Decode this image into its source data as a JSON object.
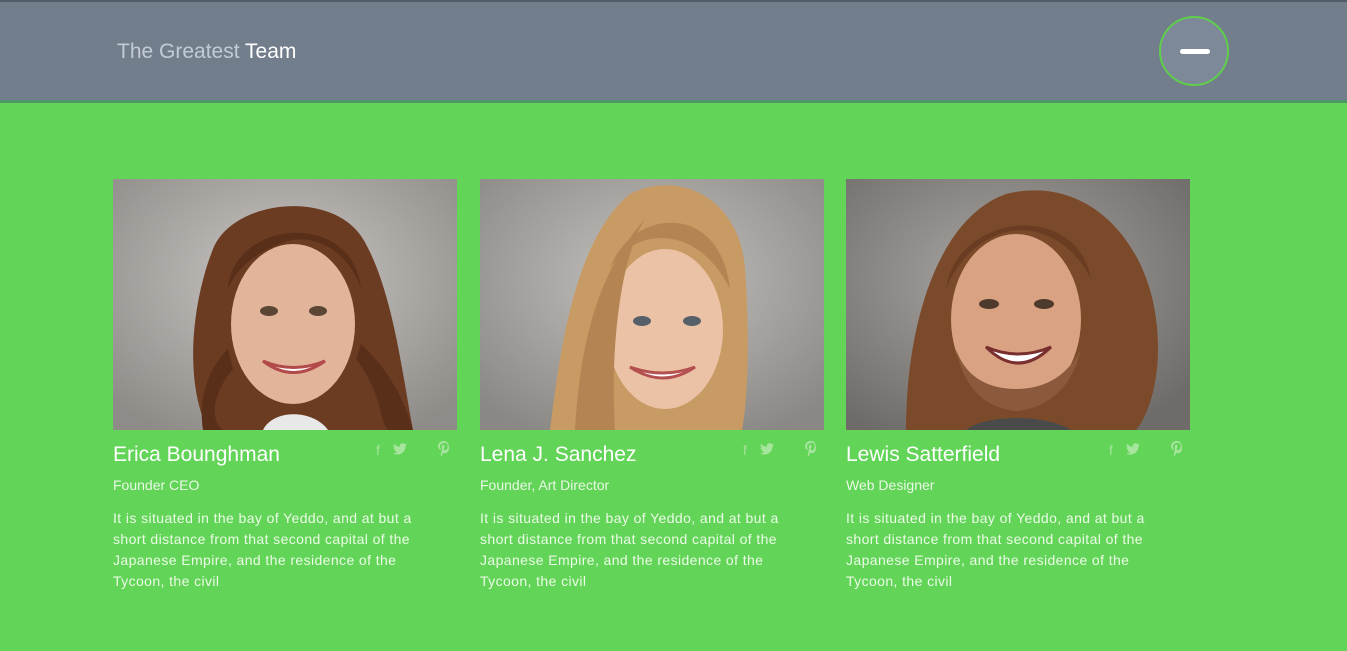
{
  "header": {
    "brand_light": "The Greatest",
    "brand_strong": "Team",
    "menu_icon": "minus-icon"
  },
  "team": [
    {
      "name": "Erica Bounghman",
      "role": "Founder CEO",
      "description": "It is situated in the bay of Yeddo, and at but a short distance from that second capital of the Japanese Empire, and the residence of the Tycoon, the civil",
      "social": [
        "facebook-icon",
        "twitter-icon",
        "pinterest-icon"
      ]
    },
    {
      "name": "Lena J. Sanchez",
      "role": "Founder, Art Director",
      "description": "It is situated in the bay of Yeddo, and at but a short distance from that second capital of the Japanese Empire, and the residence of the Tycoon, the civil",
      "social": [
        "facebook-icon",
        "twitter-icon",
        "pinterest-icon"
      ]
    },
    {
      "name": "Lewis Satterfield",
      "role": "Web Designer",
      "description": "It is situated in the bay of Yeddo, and at but a short distance from that second capital of the Japanese Empire, and the residence of the Tycoon, the civil",
      "social": [
        "facebook-icon",
        "twitter-icon",
        "pinterest-icon"
      ]
    }
  ],
  "colors": {
    "page_background": "#62d457",
    "header_background": "#737e8c",
    "menu_ring": "#5fcf4b",
    "social_icon": "#a6e59d"
  }
}
